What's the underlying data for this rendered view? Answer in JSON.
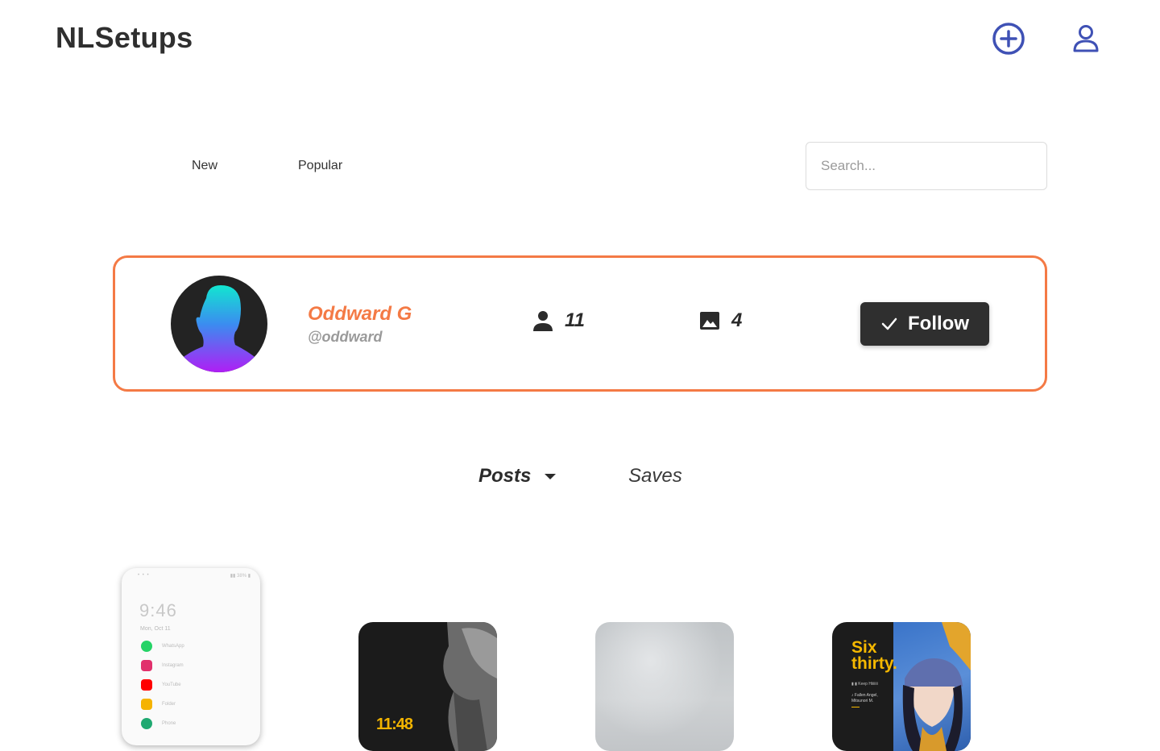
{
  "header": {
    "brand": "NLSetups",
    "add_icon": "plus-circle-icon",
    "profile_icon": "user-icon",
    "accent_color": "#3f51b5"
  },
  "sort": {
    "new_label": "New",
    "popular_label": "Popular"
  },
  "search": {
    "placeholder": "Search..."
  },
  "profile": {
    "name": "Oddward G",
    "handle": "@oddward",
    "followers": "11",
    "followers_icon": "person-icon",
    "posts": "4",
    "posts_icon": "image-icon",
    "follow_label": "Follow",
    "follow_icon": "check-icon",
    "accent_color": "#f47a45"
  },
  "tabs": {
    "posts_label": "Posts",
    "saves_label": "Saves"
  },
  "posts": [
    {
      "status_left": "• • •",
      "status_right": "▮▮ 38% ▮",
      "time": "9:46",
      "date": "Mon, Oct 11",
      "apps": [
        "WhatsApp",
        "Instagram",
        "YouTube",
        "Folder",
        "Phone"
      ]
    },
    {
      "clock": "11:48"
    },
    {},
    {
      "title_line1": "Six",
      "title_line2": "thirty",
      "meta": "▮  ▮      Keep Hiiiiiii",
      "song_line1": "♪ Fallen Angel,",
      "song_line2": "Mitsunori M."
    }
  ]
}
